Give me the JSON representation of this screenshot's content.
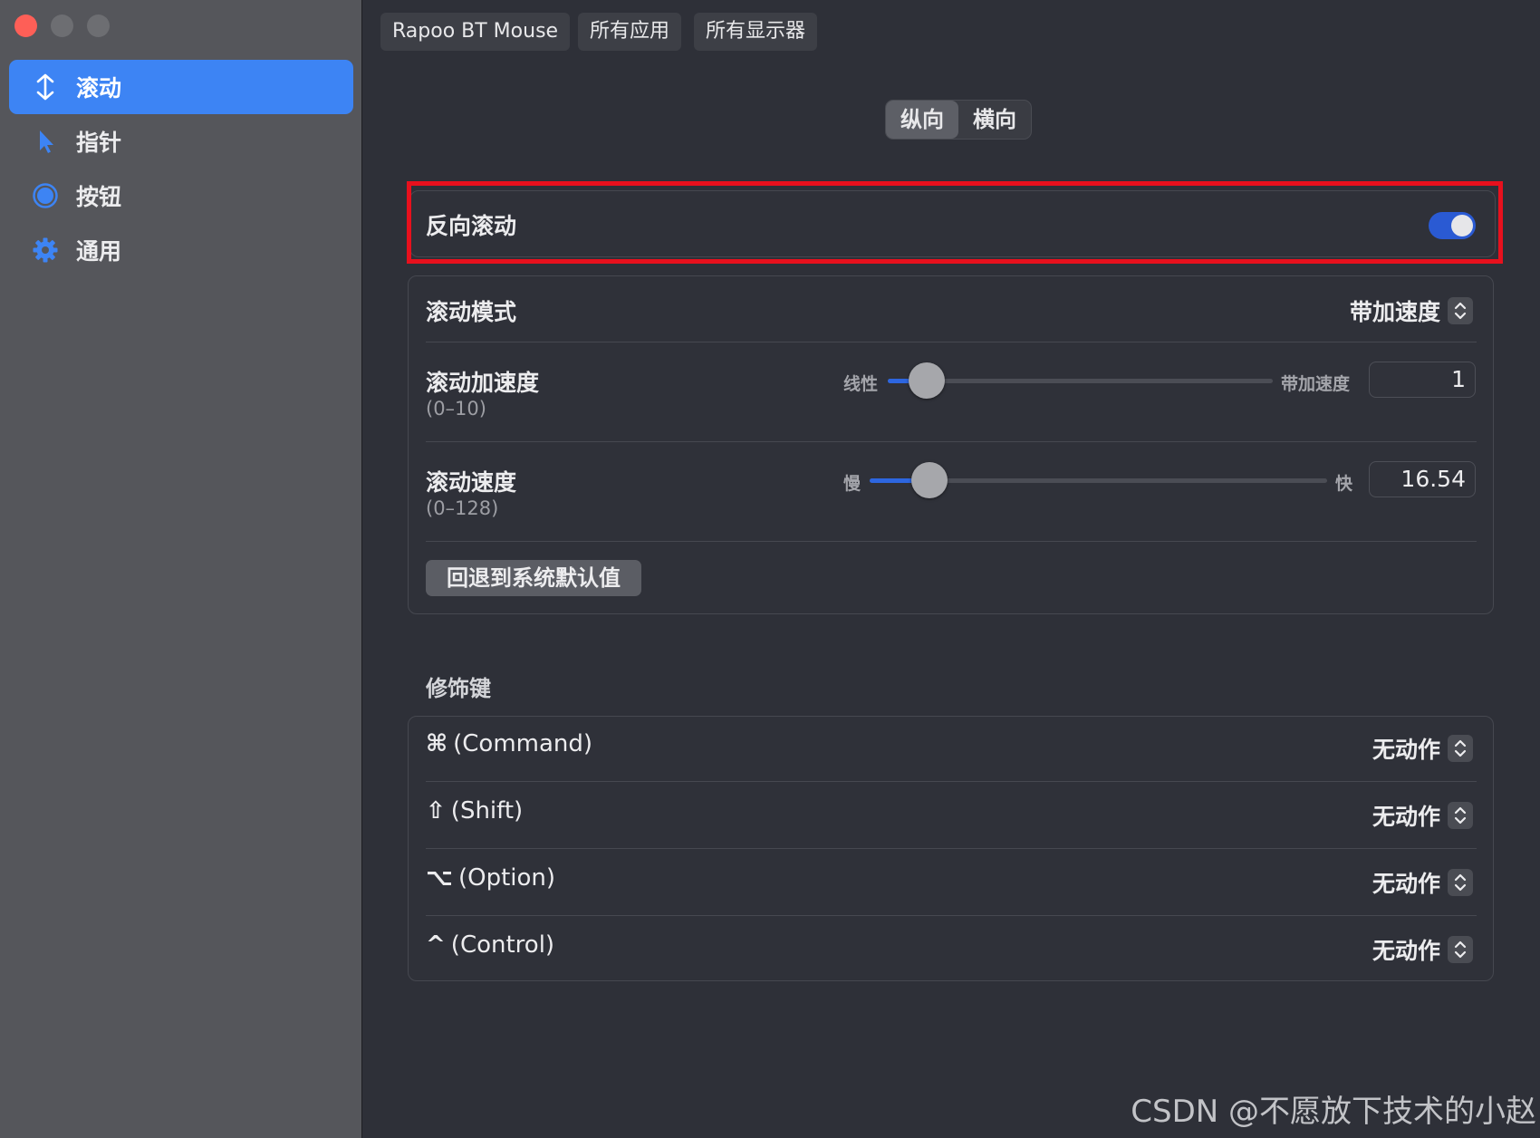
{
  "window": {
    "traffic_lights": [
      "close",
      "minimize",
      "zoom"
    ]
  },
  "sidebar": {
    "items": [
      {
        "label": "滚动",
        "icon": "vertical-arrows-icon",
        "active": true
      },
      {
        "label": "指针",
        "icon": "pointer-icon",
        "active": false
      },
      {
        "label": "按钮",
        "icon": "button-circle-icon",
        "active": false
      },
      {
        "label": "通用",
        "icon": "gear-icon",
        "active": false
      }
    ]
  },
  "device_tabs": [
    "Rapoo BT Mouse",
    "所有应用",
    "所有显示器"
  ],
  "orientation": {
    "options": [
      "纵向",
      "横向"
    ],
    "selected": "纵向"
  },
  "reverse_scroll": {
    "label": "反向滚动",
    "enabled": true
  },
  "scroll_settings": {
    "mode": {
      "label": "滚动模式",
      "value": "带加速度"
    },
    "acceleration": {
      "label": "滚动加速度",
      "range": "(0–10)",
      "min_label": "线性",
      "max_label": "带加速度",
      "value": "1",
      "fraction": 0.1
    },
    "speed": {
      "label": "滚动速度",
      "range": "(0–128)",
      "min_label": "慢",
      "max_label": "快",
      "value": "16.54",
      "fraction": 0.13
    },
    "reset_button": "回退到系统默认值"
  },
  "modifiers": {
    "title": "修饰键",
    "rows": [
      {
        "glyph": "⌘",
        "label": "(Command)",
        "value": "无动作"
      },
      {
        "glyph": "⇧",
        "label": "(Shift)",
        "value": "无动作"
      },
      {
        "glyph": "⌥",
        "label": "(Option)",
        "value": "无动作"
      },
      {
        "glyph": "^",
        "label": "(Control)",
        "value": "无动作"
      }
    ]
  },
  "watermark": "CSDN @不愿放下技术的小赵",
  "colors": {
    "accent": "#3d84f4",
    "toggle_on": "#2a5ad3",
    "highlight_box": "#e8101d"
  }
}
